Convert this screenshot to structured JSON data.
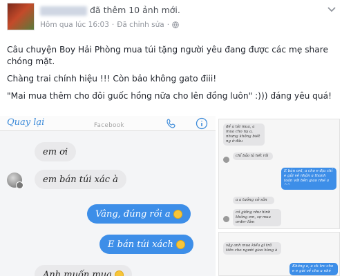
{
  "post": {
    "action_text": "đã thêm 10 ảnh mới.",
    "time": "Hôm qua lúc 16:03",
    "separator": "·",
    "edited": "Đã chỉnh sửa",
    "caption": [
      "Câu chuyện Boy Hải Phòng mua túi tặng người yêu đang được các mẹ share chóng mặt.",
      "Chàng trai chính hiệu !!! Còn bảo không gato điii!",
      "\"Mai mua thêm cho đôi guốc hồng nữa cho lên đồng luôn\" :))) đáng yêu quá!"
    ]
  },
  "photo": {
    "messenger": {
      "back_label": "Quay lại",
      "title": "Facebook"
    },
    "messages": [
      {
        "side": "in",
        "text": "em ơi"
      },
      {
        "side": "in",
        "text": "em bán túi xác à"
      },
      {
        "side": "out",
        "text": "Vâng, đúng rồi a",
        "emoji": "smile"
      },
      {
        "side": "out",
        "text": "E bán túi xách",
        "emoji": "laugh"
      },
      {
        "side": "in",
        "text": "Anh muốn mua",
        "emoji": "smile"
      }
    ],
    "thumb_top": [
      {
        "side": "in",
        "text": "đề a tới mua, a mua cho ny a, nhưng không biết ng ở đâu"
      },
      {
        "side": "in",
        "text": "chỉ bảo là hết rồi"
      },
      {
        "side": "out",
        "text": "E bán onl, a cho e địa chỉ e gửi về nhận a thanh toán với bên giao nhé a ^^"
      },
      {
        "side": "in",
        "text": "a a tưởng cở sẵn"
      },
      {
        "side": "in",
        "text": "có giống như hình không em, sợ mua order lắm"
      }
    ],
    "thumb_bottom": [
      {
        "side": "in",
        "text": "vậy anh mua kiểu gì trả tiền cho người giao hàng à"
      },
      {
        "side": "out",
        "text": "Không a, a ck trc cho e e gửi về cho a nhé"
      }
    ]
  }
}
